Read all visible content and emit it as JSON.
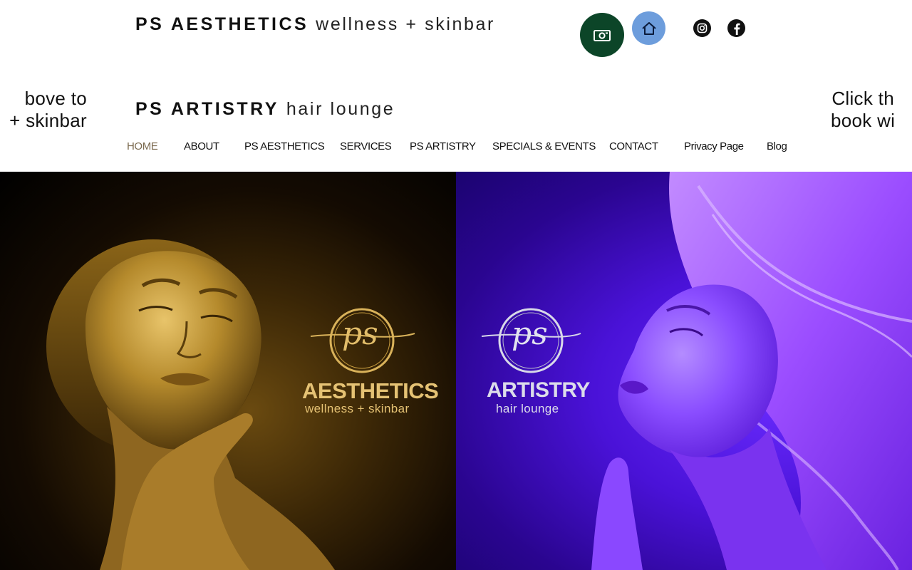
{
  "header": {
    "aesthetics_brand_bold": "PS AESTHETICS",
    "aesthetics_brand_light": "wellness + skinbar",
    "artistry_brand_bold": "PS ARTISTRY",
    "artistry_brand_light": "hair lounge"
  },
  "side_text": {
    "left_line1": "bove to",
    "left_line2": "+ skinbar",
    "right_line1": "Click th",
    "right_line2": "book wi"
  },
  "nav": {
    "items": [
      {
        "label": "HOME"
      },
      {
        "label": "ABOUT"
      },
      {
        "label": "PS AESTHETICS"
      },
      {
        "label": "SERVICES"
      },
      {
        "label": "PS ARTISTRY"
      },
      {
        "label": "SPECIALS & EVENTS"
      },
      {
        "label": "CONTACT"
      },
      {
        "label": "Privacy Page"
      },
      {
        "label": "Blog"
      }
    ],
    "active_index": 0
  },
  "hero": {
    "left_logo": {
      "monogram": "ps",
      "title": "AESTHETICS",
      "subtitle": "wellness + skinbar"
    },
    "right_logo": {
      "monogram": "ps",
      "title": "ARTISTRY",
      "subtitle": "hair lounge"
    }
  },
  "icons": {
    "book_aesthetics": "money-camera-icon",
    "book_artistry": "home-icon",
    "instagram": "instagram-icon",
    "facebook": "facebook-icon"
  },
  "colors": {
    "aesthetics_button": "#0c4528",
    "artistry_button": "#6d9ddc",
    "nav_active": "#7b6a4f",
    "gold": "#d9b25a",
    "silver": "#d8d8e8"
  }
}
